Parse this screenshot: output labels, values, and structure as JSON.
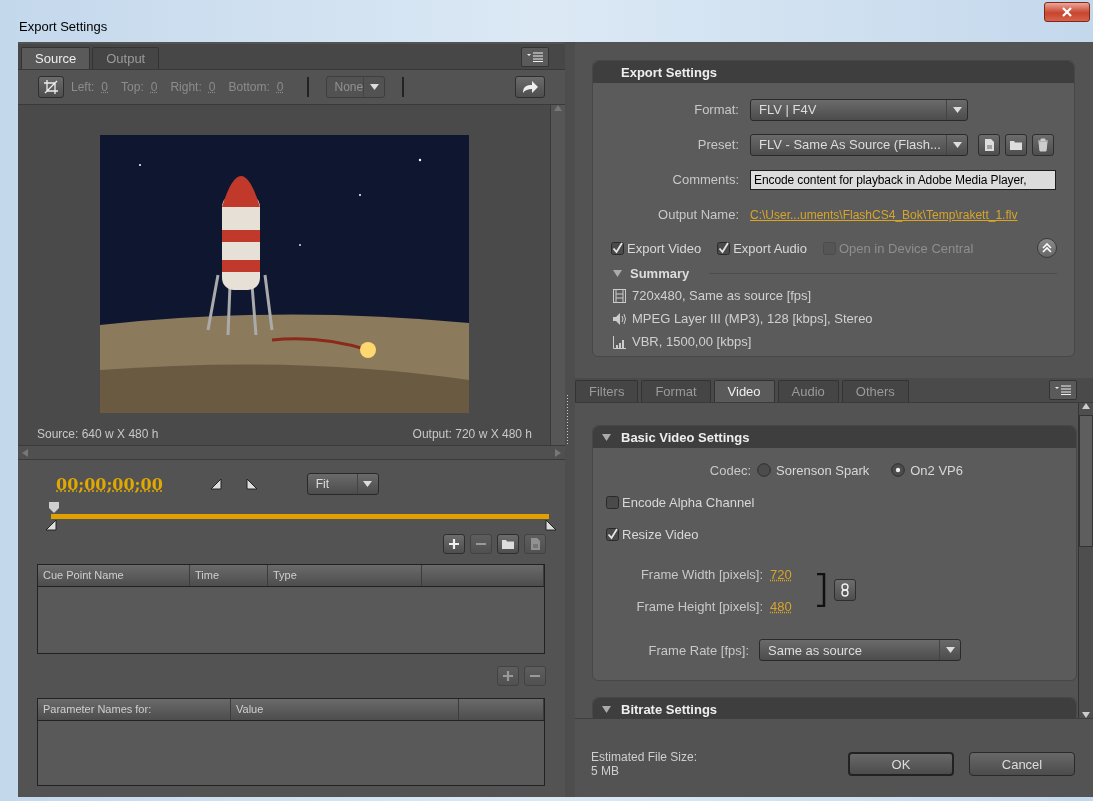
{
  "window": {
    "title": "Export Settings"
  },
  "source_panel": {
    "tabs": [
      {
        "label": "Source",
        "selected": true
      },
      {
        "label": "Output",
        "selected": false
      }
    ],
    "crop_toolbar": {
      "disabled": true,
      "fields": [
        {
          "label": "Left:",
          "value": "0"
        },
        {
          "label": "Top:",
          "value": "0"
        },
        {
          "label": "Right:",
          "value": "0"
        },
        {
          "label": "Bottom:",
          "value": "0"
        }
      ],
      "aspect": {
        "value": "None",
        "disabled": true
      }
    },
    "preview": {
      "kind": "picture",
      "source_size": "Source: 640 w X 480 h",
      "output_size": "Output: 720 w X 480 h"
    },
    "timecode": "00;00;00;00",
    "zoom": {
      "value": "Fit"
    },
    "timeline": {
      "level": 0
    },
    "cue_buttons": [
      {
        "kind": "add",
        "disabled": false
      },
      {
        "kind": "remove",
        "disabled": true
      },
      {
        "kind": "open",
        "disabled": false
      },
      {
        "kind": "save",
        "disabled": true
      }
    ],
    "cue_table": {
      "columns": [
        "Cue Point Name",
        "Time",
        "Type"
      ]
    },
    "param_buttons": [
      {
        "kind": "add",
        "disabled": true
      },
      {
        "kind": "remove",
        "disabled": true
      }
    ],
    "param_table": {
      "columns": [
        "Parameter Names for:",
        "Value"
      ]
    }
  },
  "export_settings": {
    "title": "Export Settings",
    "format": {
      "label": "Format:",
      "value": "FLV | F4V"
    },
    "preset": {
      "label": "Preset:",
      "value": "FLV - Same As Source (Flash..."
    },
    "comments": {
      "label": "Comments:",
      "value": "Encode content for playback in Adobe Media Player,"
    },
    "output_name": {
      "label": "Output Name:",
      "value": "C:\\User...uments\\FlashCS4_Bok\\Temp\\rakett_1.flv"
    },
    "options": [
      {
        "label": "Export Video",
        "checked": true,
        "disabled": false
      },
      {
        "label": "Export Audio",
        "checked": true,
        "disabled": false
      },
      {
        "label": "Open in Device Central",
        "checked": false,
        "disabled": true
      }
    ],
    "summary": {
      "title": "Summary",
      "expanded": true,
      "lines": [
        {
          "kind": "video",
          "text": "720x480, Same as source [fps]"
        },
        {
          "kind": "audio",
          "text": "MPEG Layer III (MP3), 128 [kbps], Stereo"
        },
        {
          "kind": "bitrate",
          "text": "VBR, 1500,00 [kbps]"
        }
      ]
    }
  },
  "settings_tabs": [
    {
      "label": "Filters",
      "selected": false
    },
    {
      "label": "Format",
      "selected": false
    },
    {
      "label": "Video",
      "selected": true
    },
    {
      "label": "Audio",
      "selected": false
    },
    {
      "label": "Others",
      "selected": false
    }
  ],
  "basic_video": {
    "title": "Basic Video Settings",
    "expanded": true,
    "codec": {
      "label": "Codec:",
      "options": [
        {
          "label": "Sorenson Spark",
          "selected": false
        },
        {
          "label": "On2 VP6",
          "selected": true
        }
      ]
    },
    "checks": [
      {
        "label": "Encode Alpha Channel",
        "checked": false
      },
      {
        "label": "Resize Video",
        "checked": true
      }
    ],
    "frame_width": {
      "label": "Frame Width [pixels]:",
      "value": "720"
    },
    "frame_height": {
      "label": "Frame Height [pixels]:",
      "value": "480"
    },
    "frame_rate": {
      "label": "Frame Rate [fps]:",
      "value": "Same as source"
    }
  },
  "bitrate": {
    "title": "Bitrate Settings",
    "expanded": true
  },
  "footer": {
    "estimate_label": "Estimated File Size:",
    "estimate": "5 MB",
    "buttons": [
      {
        "label": "OK",
        "default": true
      },
      {
        "label": "Cancel",
        "default": false
      }
    ]
  }
}
